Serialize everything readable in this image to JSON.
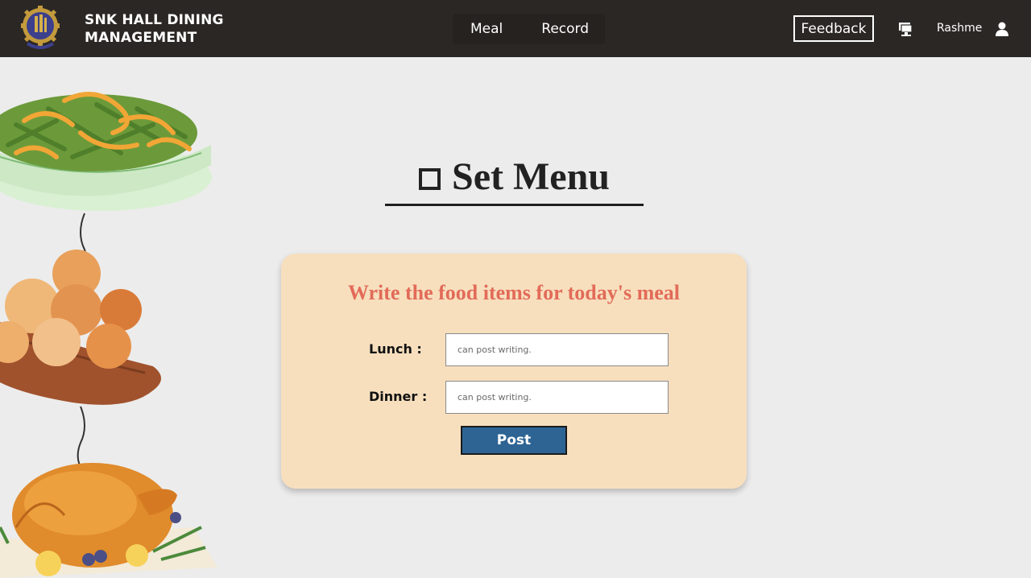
{
  "navbar": {
    "brand_line1": "SNK HALL DINING",
    "brand_line2": "MANAGEMENT",
    "links": [
      "Meal",
      "Record"
    ],
    "feedback_label": "Feedback",
    "username": "Rashme",
    "icons": [
      "university-logo-icon",
      "monitor-icon",
      "user-icon"
    ]
  },
  "page": {
    "title": "Set Menu"
  },
  "form": {
    "instruction": "Write the food items for today's meal",
    "lunch_label": "Lunch :",
    "dinner_label": "Dinner :",
    "lunch_placeholder": "can post writing.",
    "dinner_placeholder": "can post writing.",
    "lunch_value": "",
    "dinner_value": "",
    "submit_label": "Post"
  },
  "colors": {
    "navbar_bg": "#2b2724",
    "page_bg": "#ececec",
    "card_bg": "#f7dfbe",
    "instruction_text": "#e26b58",
    "post_button": "#2e6494"
  }
}
